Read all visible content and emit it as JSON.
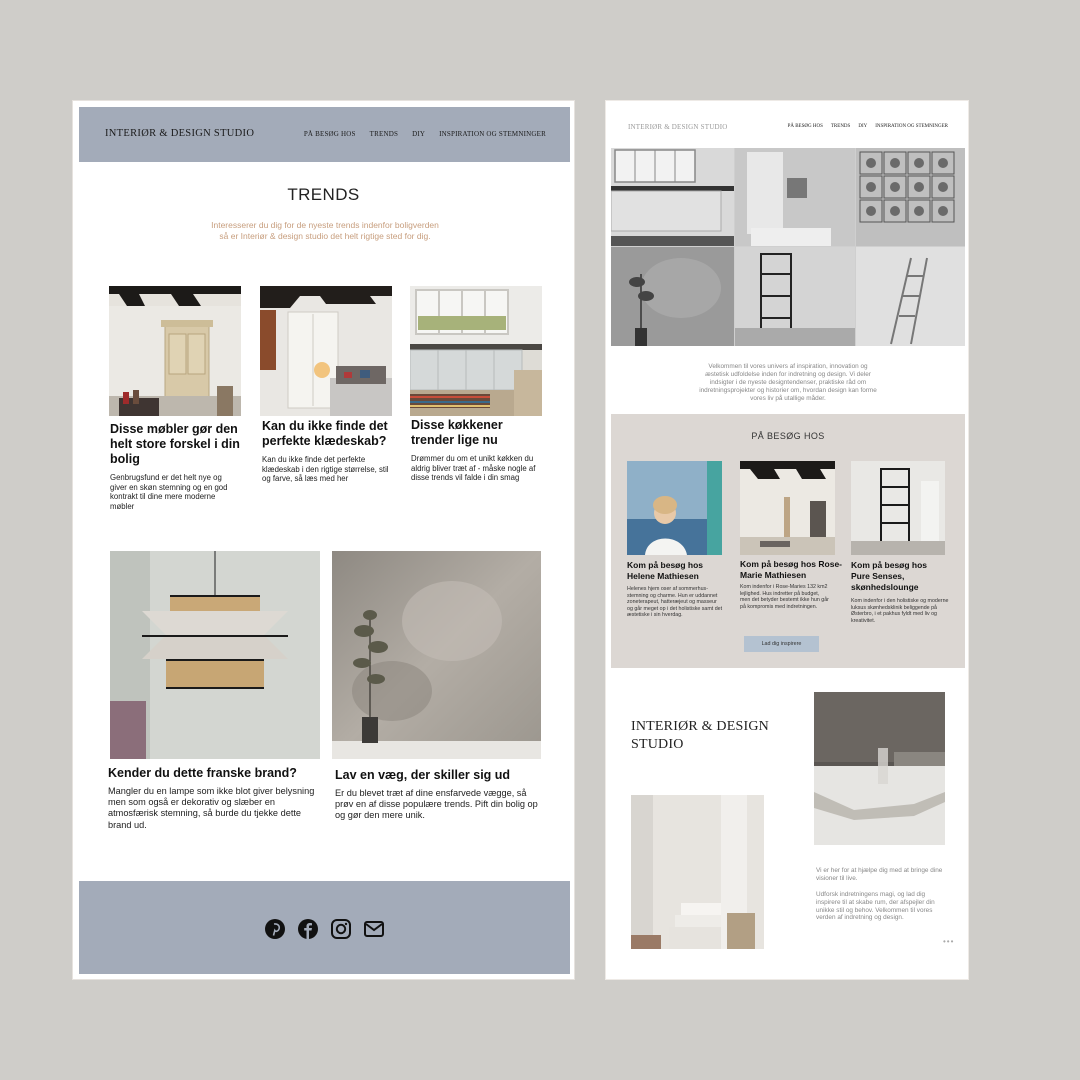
{
  "left_page": {
    "header": {
      "logo": "INTERIØR & DESIGN STUDIO",
      "nav": [
        "PÅ BESØG HOS",
        "TRENDS",
        "DIY",
        "INSPIRATION OG STEMNINGER"
      ]
    },
    "title": "TRENDS",
    "intro": "Interesserer du dig for de nyeste trends indenfor boligverden så er Interiør & design studio det helt rigtige sted for dig.",
    "cards": [
      {
        "title": "Disse møbler gør den helt store forskel i din bolig",
        "text": "Genbrugsfund er det helt nye og giver en skøn stemning og en god kontrakt til dine mere moderne møbler"
      },
      {
        "title": "Kan du ikke finde det perfekte klædeskab?",
        "text": "Kan du ikke finde det perfekte klædeskab i den rigtige størrelse, stil og farve, så læs med her"
      },
      {
        "title": "Disse køkkener trender lige nu",
        "text": "Drømmer du om et unikt køkken du aldrig bliver træt af - måske nogle af disse trends vil falde i din smag"
      }
    ],
    "large_cards": [
      {
        "title": "Kender du dette franske brand?",
        "text": "Mangler du en lampe som ikke blot giver belysning men som også er dekorativ og slæber en atmosfærisk stemning, så burde du tjekke dette brand ud."
      },
      {
        "title": "Lav en væg, der skiller sig ud",
        "text": "Er du blevet træt af dine ensfarvede vægge, så prøv en af disse populære trends. Pift din bolig op og gør den mere unik."
      }
    ],
    "footer": {
      "social_icons": [
        "pinterest-icon",
        "facebook-icon",
        "instagram-icon",
        "mail-icon"
      ]
    }
  },
  "right_page": {
    "header": {
      "logo": "INTERIØR & DESIGN STUDIO",
      "nav": [
        "PÅ BESØG HOS",
        "TRENDS",
        "DIY",
        "INSPIRATION OG STEMNINGER"
      ]
    },
    "welcome": "Velkommen til vores univers af inspiration, innovation og æstetisk udfoldelse inden for indretning og design. Vi deler indsigter i de nyeste designtendenser, praktiske råd om indretningsprojekter og historier om, hvordan design kan forme vores liv på utallige måder.",
    "visit": {
      "title": "PÅ BESØG HOS",
      "cards": [
        {
          "title": "Kom på besøg hos Helene Mathiesen",
          "text": "Helenes hjem oser af sommerhus-stemning og charme. Hun er uddannet zoneterapeut, hatteræjeut og masseur og går meget op i det holistiske samt det æstetiske i sin hverdag."
        },
        {
          "title": "Kom på besøg hos Rose-Marie Mathiesen",
          "text": "Kom indenfor i Rose-Maries 132 km2 lejlighed. Hus indretter på budget, men det betyder bestemt ikke hun går på kompromis med indretningen."
        },
        {
          "title": "Kom på besøg hos Pure Senses, skønhedslounge",
          "text": "Kom indenfor i den holistiske og moderne luksus skønhedsklinik beliggende på Østerbro, i et pakhus fyldt med liv og kreativitet."
        }
      ],
      "button": "Lad dig inspirere"
    },
    "studio": {
      "title_line1": "INTERIØR & DESIGN",
      "title_line2": "STUDIO",
      "text1": "Vi er her for at hjælpe dig med at bringe dine visioner til live.",
      "text2": "Udforsk indretningens magi, og lad dig inspirere til at skabe rum, der afspejler din unikke stil og behov. Velkommen til vores verden af indretning og design.",
      "more": "•••"
    }
  }
}
